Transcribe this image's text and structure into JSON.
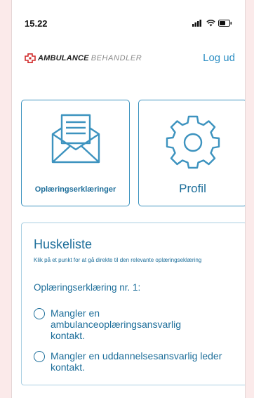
{
  "status_bar": {
    "time": "15.22",
    "icons": [
      "signal-icon",
      "wifi-icon",
      "battery-icon"
    ]
  },
  "header": {
    "logo_bold": "AMBULANCE",
    "logo_light": "BEHANDLER",
    "logo_icon": "ambulance-cross-icon",
    "logout_label": "Log ud"
  },
  "tiles": [
    {
      "label": "Oplæringserklæringer",
      "icon": "envelope-icon"
    },
    {
      "label": "Profil",
      "icon": "gear-icon"
    }
  ],
  "checklist": {
    "title": "Huskeliste",
    "hint": "Klik på et punkt for at gå direkte til den relevante oplæringseklæring",
    "section_title": "Oplæringserklæring nr. 1:",
    "items": [
      {
        "label": "Mangler en ambulanceoplæringsansvarlig kontakt.",
        "checked": false
      },
      {
        "label": "Mangler en uddannelsesansvarlig leder kontakt.",
        "checked": false
      }
    ]
  },
  "colors": {
    "accent": "#1d6e9a",
    "link": "#2e8fc4",
    "border": "#3d93bf",
    "logo_red": "#d12b2b",
    "background": "#fbeaea"
  }
}
